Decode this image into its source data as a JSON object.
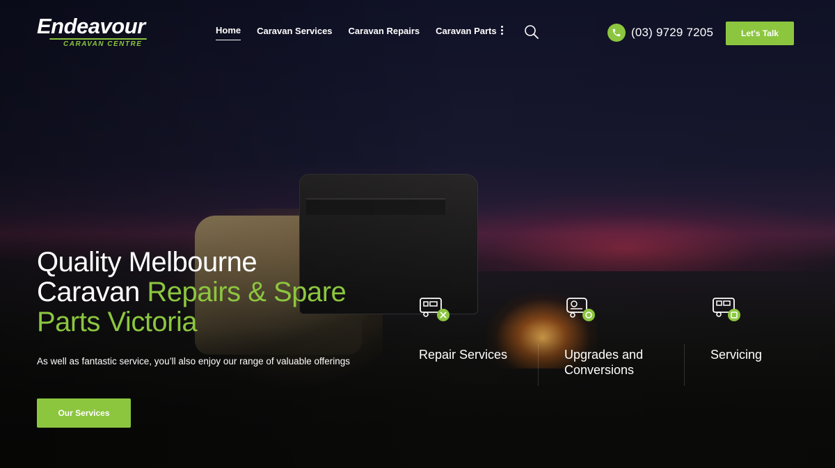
{
  "brand": {
    "name": "Endeavour",
    "tagline": "CARAVAN CENTRE",
    "accent_color": "#8cc63f"
  },
  "nav": {
    "items": [
      {
        "label": "Home",
        "active": true
      },
      {
        "label": "Caravan Services",
        "active": false
      },
      {
        "label": "Caravan Repairs",
        "active": false
      },
      {
        "label": "Caravan Parts",
        "active": false
      }
    ],
    "more_icon": "vertical-dots-icon",
    "search_icon": "search-icon"
  },
  "contact": {
    "phone": "(03) 9729 7205",
    "phone_icon": "phone-icon",
    "cta_label": "Let's Talk"
  },
  "hero": {
    "headline_white_1": "Quality Melbourne",
    "headline_white_2": "Caravan ",
    "headline_green": "Repairs & Spare Parts Victoria",
    "subtext": "As well as fantastic service, you’ll also enjoy our range of valuable offerings",
    "button_label": "Our Services"
  },
  "services": [
    {
      "label": "Repair Services",
      "icon": "caravan-repair-icon"
    },
    {
      "label": "Upgrades and Conversions",
      "icon": "caravan-upgrade-icon"
    },
    {
      "label": "Servicing",
      "icon": "caravan-servicing-icon"
    }
  ]
}
